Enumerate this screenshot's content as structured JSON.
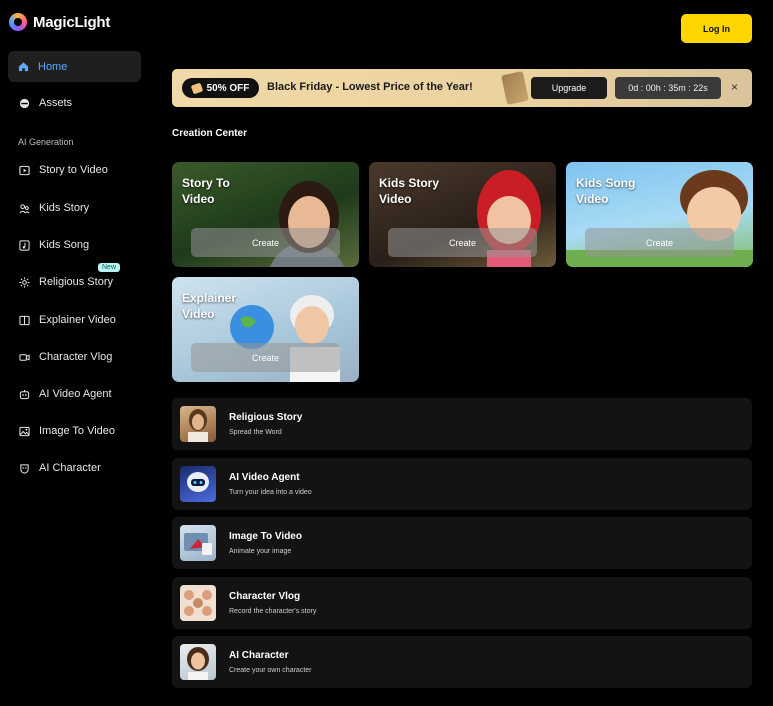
{
  "brand": {
    "name": "MagicLight"
  },
  "header": {
    "login_label": "Log In"
  },
  "sidebar": {
    "home_label": "Home",
    "assets_label": "Assets",
    "section_label": "AI Generation",
    "new_badge": "New",
    "items": [
      {
        "label": "Story to Video",
        "icon": "play-square-icon"
      },
      {
        "label": "Kids Story",
        "icon": "kids-icon"
      },
      {
        "label": "Kids Song",
        "icon": "music-note-icon"
      },
      {
        "label": "Religious Story",
        "icon": "sparkle-icon"
      },
      {
        "label": "Explainer Video",
        "icon": "book-icon"
      },
      {
        "label": "Character Vlog",
        "icon": "video-camera-icon"
      },
      {
        "label": "AI Video Agent",
        "icon": "robot-icon"
      },
      {
        "label": "Image To Video",
        "icon": "image-icon"
      },
      {
        "label": "AI Character",
        "icon": "character-icon"
      }
    ]
  },
  "promo": {
    "badge": "50% OFF",
    "text": "Black Friday - Lowest Price of the Year!",
    "upgrade_label": "Upgrade",
    "timer": "0d : 00h : 35m : 22s",
    "close": "×"
  },
  "creation": {
    "title": "Creation Center",
    "cards": [
      {
        "title": "Story To Video",
        "button": "Create"
      },
      {
        "title": "Kids Story Video",
        "button": "Create"
      },
      {
        "title": "Kids Song Video",
        "button": "Create"
      },
      {
        "title": "Explainer Video",
        "button": "Create"
      }
    ]
  },
  "tools": [
    {
      "title": "Religious Story",
      "subtitle": "Spread the Word"
    },
    {
      "title": "AI Video Agent",
      "subtitle": "Turn your idea into a video"
    },
    {
      "title": "Image To Video",
      "subtitle": "Animate your image"
    },
    {
      "title": "Character Vlog",
      "subtitle": "Record the character's story"
    },
    {
      "title": "AI Character",
      "subtitle": "Create your own character"
    }
  ],
  "colors": {
    "accent": "#5aa9ff",
    "login": "#ffd600",
    "badge_new": "#b7f3f2"
  }
}
